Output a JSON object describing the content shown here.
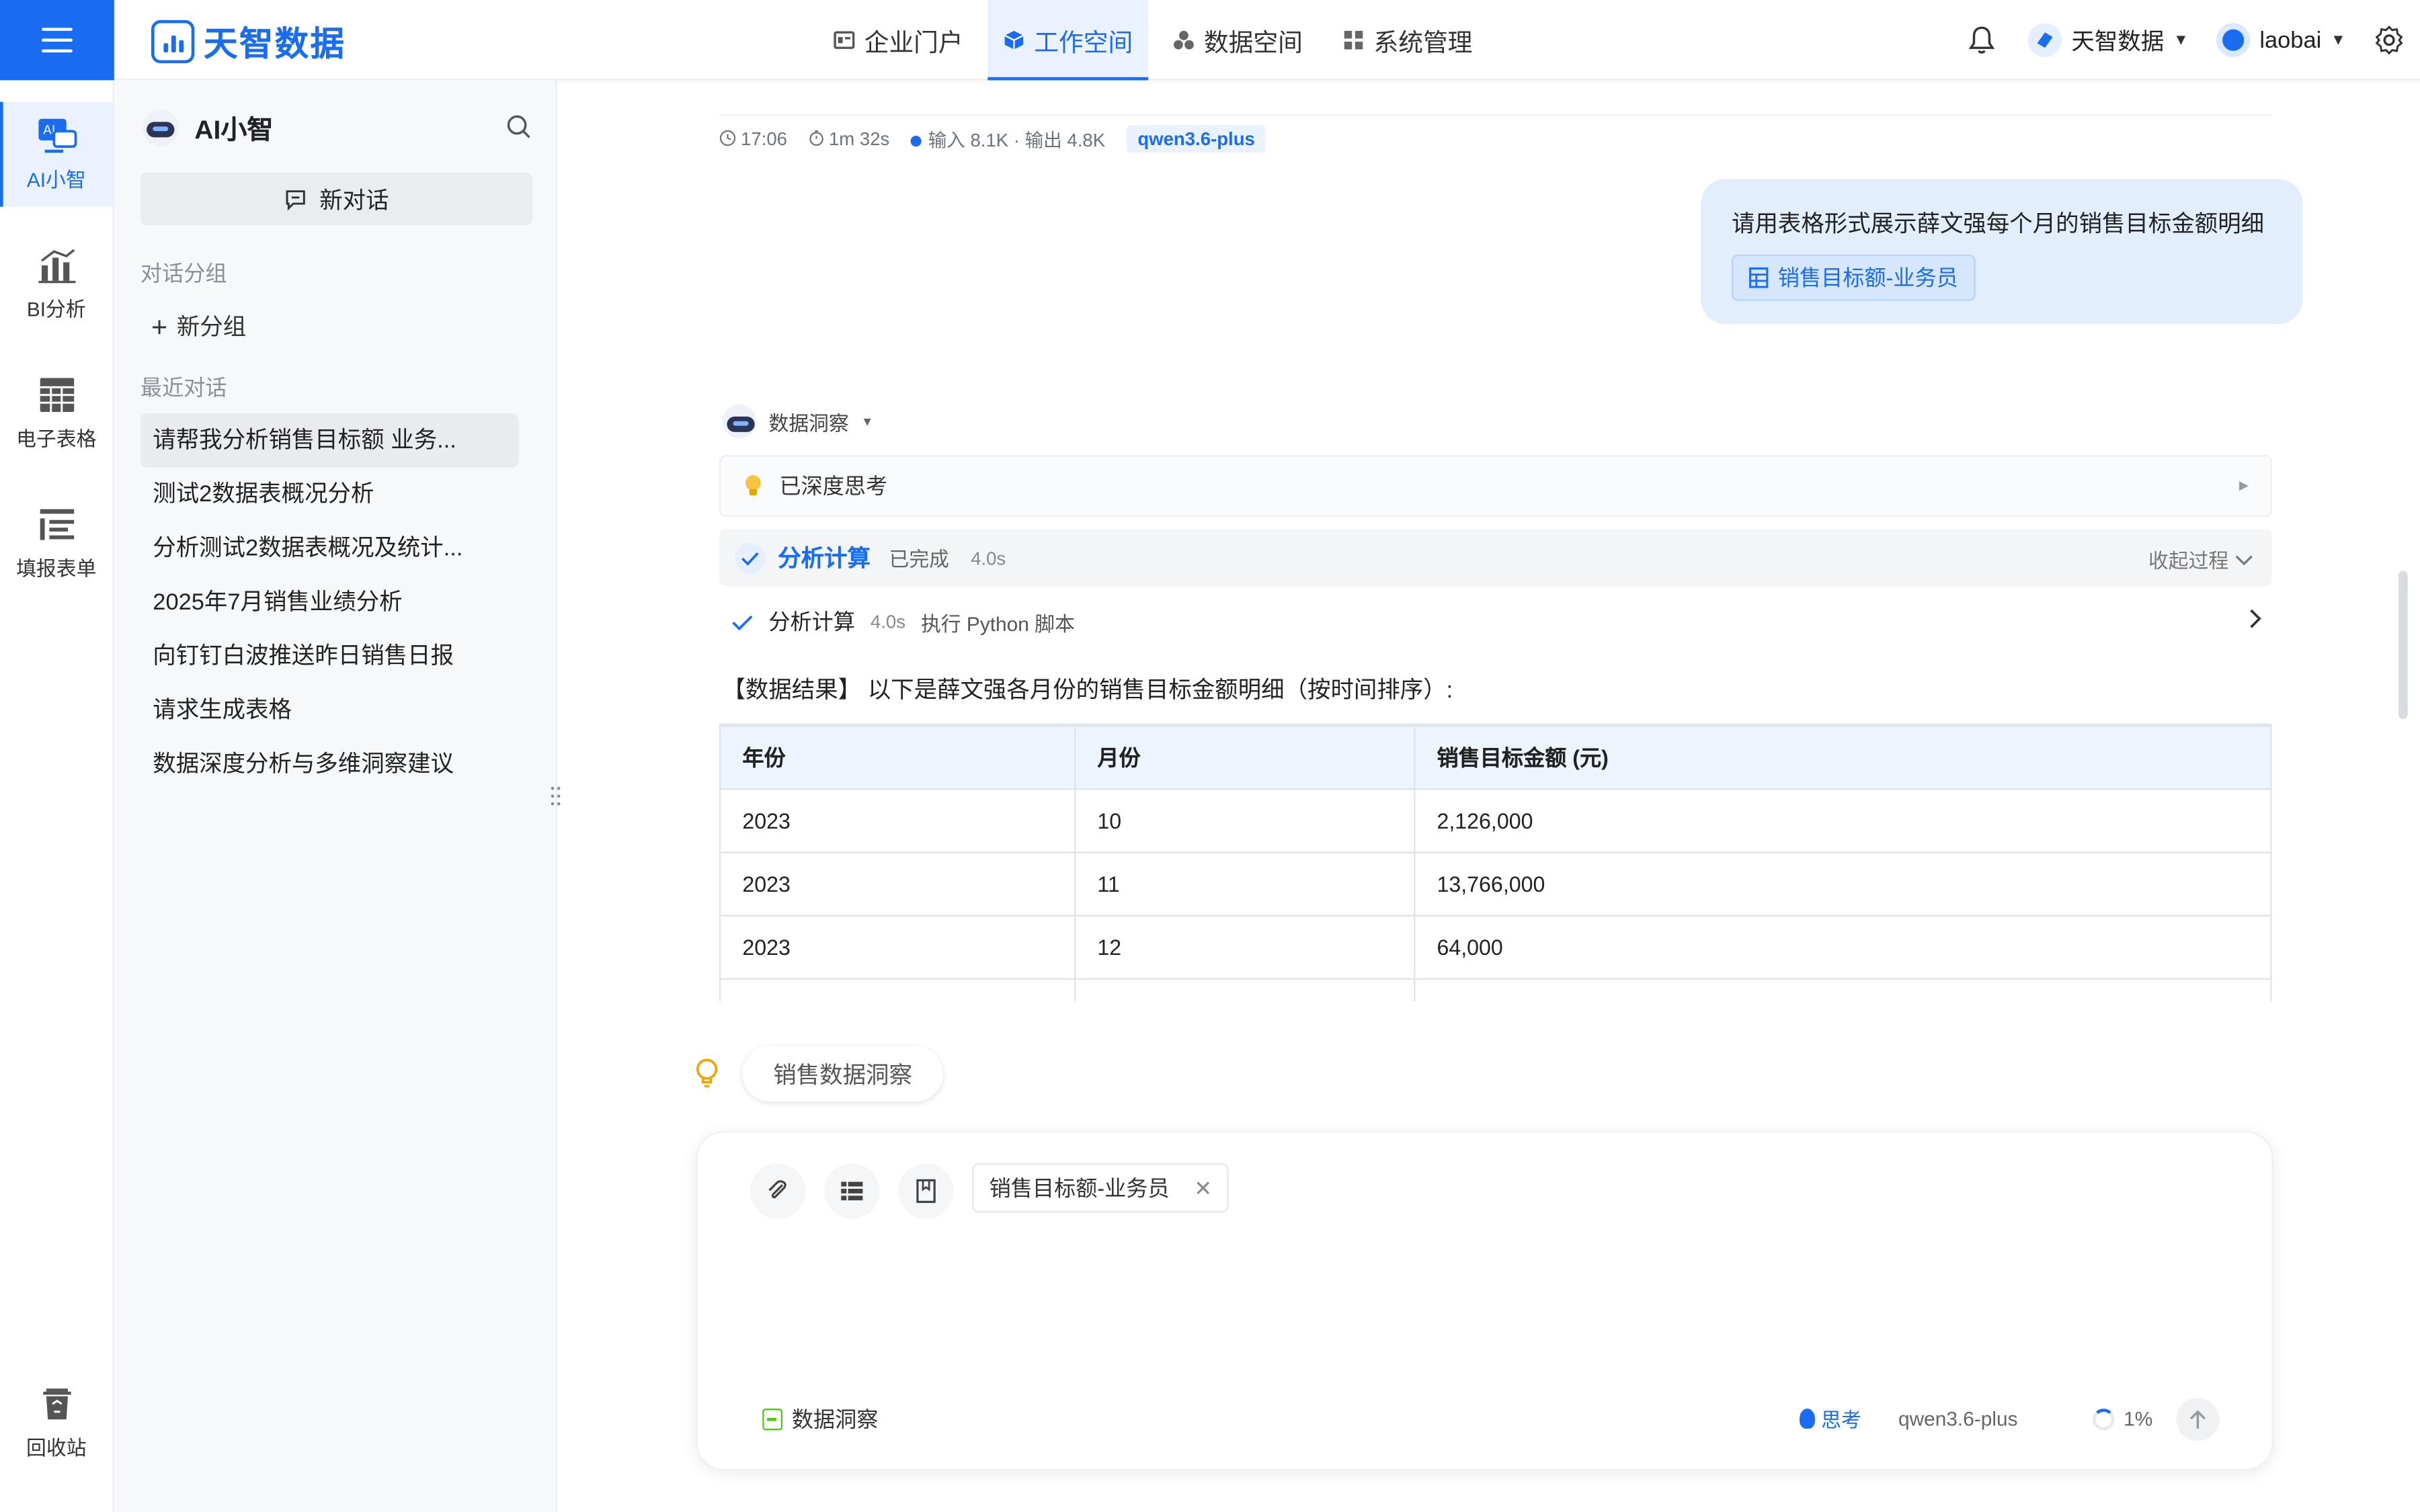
{
  "brand": {
    "name": "天智数据",
    "color": "#1a6cf0"
  },
  "topnav": [
    {
      "label": "企业门户",
      "icon": "portal-icon",
      "active": false
    },
    {
      "label": "工作空间",
      "icon": "cube-icon",
      "active": true
    },
    {
      "label": "数据空间",
      "icon": "cluster-icon",
      "active": false
    },
    {
      "label": "系统管理",
      "icon": "grid-icon",
      "active": false
    }
  ],
  "topright": {
    "tenant": "天智数据",
    "user": "laobai"
  },
  "rail": [
    {
      "label": "AI小智",
      "icon": "ai-assistant-icon",
      "active": true
    },
    {
      "label": "BI分析",
      "icon": "bar-chart-icon",
      "active": false
    },
    {
      "label": "电子表格",
      "icon": "spreadsheet-icon",
      "active": false
    },
    {
      "label": "填报表单",
      "icon": "form-icon",
      "active": false
    },
    {
      "label": "回收站",
      "icon": "recycle-bin-icon",
      "active": false
    }
  ],
  "sidebar": {
    "title": "AI小智",
    "new_chat": "新对话",
    "group_label": "对话分组",
    "new_group": "新分组",
    "recent_label": "最近对话",
    "conversations": [
      "请帮我分析销售目标额 业务...",
      "测试2数据表概况分析",
      "分析测试2数据表概况及统计...",
      "2025年7月销售业绩分析",
      "向钉钉白波推送昨日销售日报",
      "请求生成表格",
      "数据深度分析与多维洞察建议"
    ]
  },
  "meta": {
    "time": "17:06",
    "duration": "1m 32s",
    "tokens": "输入 8.1K · 输出 4.8K",
    "model": "qwen3.6-plus"
  },
  "user_message": {
    "text": "请用表格形式展示薛文强每个月的销售目标金额明细",
    "table_ref": "销售目标额-业务员"
  },
  "agent": {
    "name": "数据洞察",
    "thinking_label": "已深度思考",
    "calc_title": "分析计算",
    "calc_status": "已完成",
    "calc_time": "4.0s",
    "collapse_label": "收起过程",
    "step": {
      "title": "分析计算",
      "time": "4.0s",
      "desc": "执行 Python 脚本"
    },
    "result_text": "【数据结果】 以下是薛文强各月份的销售目标金额明细（按时间排序）:"
  },
  "table": {
    "headers": [
      "年份",
      "月份",
      "销售目标金额 (元)"
    ],
    "rows": [
      [
        "2023",
        "10",
        "2,126,000"
      ],
      [
        "2023",
        "11",
        "13,766,000"
      ],
      [
        "2023",
        "12",
        "64,000"
      ]
    ]
  },
  "suggestion": "销售数据洞察",
  "composer": {
    "attachment": "销售目标额-业务员",
    "mode": "数据洞察",
    "think_label": "思考",
    "model": "qwen3.6-plus",
    "context_usage": "1%"
  }
}
